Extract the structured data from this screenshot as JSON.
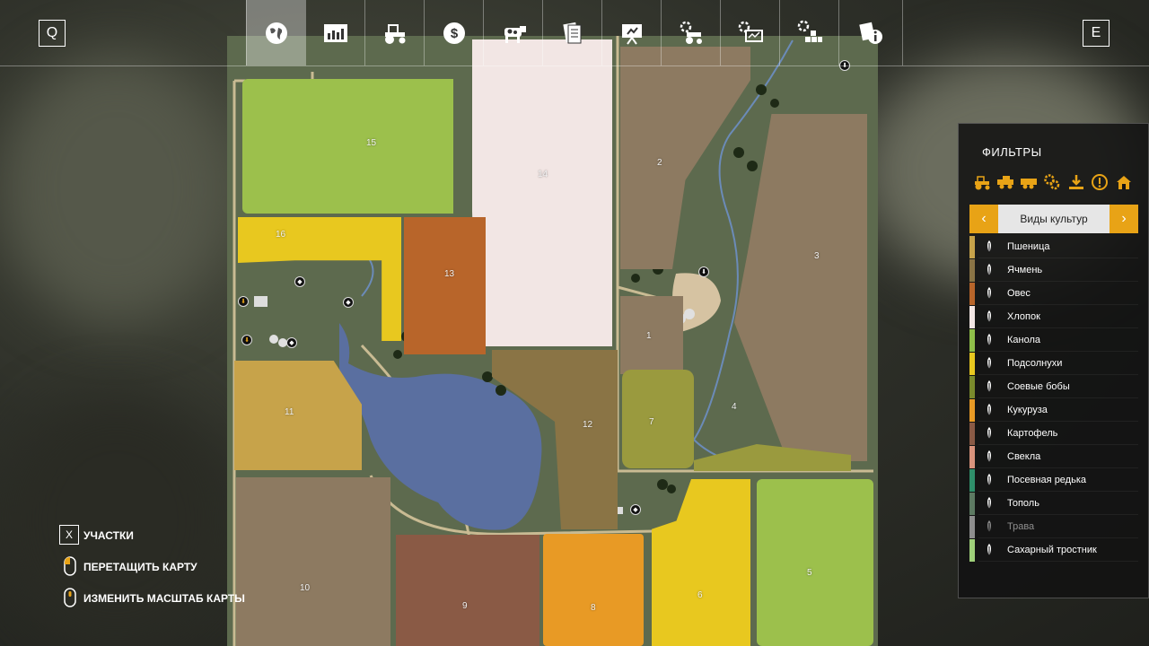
{
  "topbar": {
    "left_key": "Q",
    "right_key": "E",
    "tabs": [
      {
        "icon": "globe-map-icon",
        "active": true
      },
      {
        "icon": "statistics-chart-icon",
        "active": false
      },
      {
        "icon": "tractor-icon",
        "active": false
      },
      {
        "icon": "dollar-finance-icon",
        "active": false
      },
      {
        "icon": "cow-animals-icon",
        "active": false
      },
      {
        "icon": "contracts-papers-icon",
        "active": false
      },
      {
        "icon": "presentation-board-icon",
        "active": false
      },
      {
        "icon": "garage-settings-icon",
        "active": false
      },
      {
        "icon": "production-monitor-icon",
        "active": false
      },
      {
        "icon": "placeables-settings-icon",
        "active": false
      },
      {
        "icon": "help-info-icon",
        "active": false
      }
    ]
  },
  "map": {
    "fields": [
      "15",
      "14",
      "2",
      "3",
      "16",
      "13",
      "1",
      "11",
      "12",
      "7",
      "4",
      "10",
      "9",
      "8",
      "6",
      "5"
    ]
  },
  "filters": {
    "title": "ФИЛЬТРЫ",
    "filter_icons": [
      "tractor-filter-icon",
      "harvester-filter-icon",
      "trailer-filter-icon",
      "tools-filter-icon",
      "sell-point-filter-icon",
      "warning-filter-icon",
      "farm-home-filter-icon"
    ],
    "selector": {
      "label": "Виды культур",
      "prev": "‹",
      "next": "›"
    },
    "crops": [
      {
        "name": "Пшеница",
        "color": "#c7a34a",
        "icon": "wheat-icon"
      },
      {
        "name": "Ячмень",
        "color": "#8a7445",
        "icon": "barley-icon"
      },
      {
        "name": "Овес",
        "color": "#b8652a",
        "icon": "oat-icon"
      },
      {
        "name": "Хлопок",
        "color": "#f2e6e4",
        "icon": "cotton-icon"
      },
      {
        "name": "Канола",
        "color": "#8fbf49",
        "icon": "canola-icon"
      },
      {
        "name": "Подсолнухи",
        "color": "#e8c81f",
        "icon": "sunflower-icon"
      },
      {
        "name": "Соевые бобы",
        "color": "#7a8a2c",
        "icon": "soybean-icon"
      },
      {
        "name": "Кукуруза",
        "color": "#e89a25",
        "icon": "corn-icon"
      },
      {
        "name": "Картофель",
        "color": "#8a5a45",
        "icon": "potato-icon"
      },
      {
        "name": "Свекла",
        "color": "#d9937c",
        "icon": "beet-icon"
      },
      {
        "name": "Посевная редька",
        "color": "#2f8f6a",
        "icon": "radish-icon"
      },
      {
        "name": "Тополь",
        "color": "#5d7a62",
        "icon": "poplar-icon"
      },
      {
        "name": "Трава",
        "color": "#8e8e8e",
        "icon": "grass-icon"
      },
      {
        "name": "Сахарный тростник",
        "color": "#9fd07a",
        "icon": "sugarcane-icon"
      }
    ]
  },
  "help": {
    "items": [
      {
        "key": "X",
        "label": "УЧАСТКИ",
        "icon": "keyboard-key-icon"
      },
      {
        "label": "ПЕРЕТАЩИТЬ КАРТУ",
        "icon": "mouse-drag-icon"
      },
      {
        "label": "ИЗМЕНИТЬ МАСШТАБ КАРТЫ",
        "icon": "mouse-wheel-icon"
      }
    ]
  }
}
